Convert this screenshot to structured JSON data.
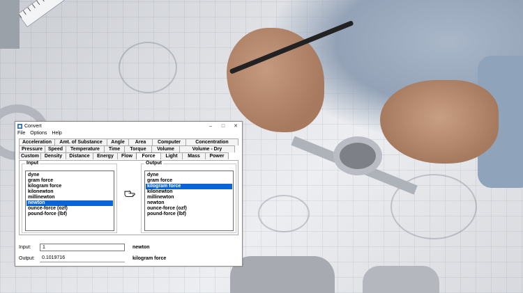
{
  "window": {
    "title": "Convert",
    "controls": {
      "minimize": "–",
      "maximize": "□",
      "close": "✕"
    }
  },
  "menu": [
    "File",
    "Options",
    "Help"
  ],
  "tabs": {
    "row1": [
      "Acceleration",
      "Amt. of Substance",
      "Angle",
      "Area",
      "Computer",
      "Concentration"
    ],
    "row2": [
      "Pressure",
      "Speed",
      "Temperature",
      "Time",
      "Torque",
      "Volume",
      "Volume - Dry"
    ],
    "row3": [
      "Custom",
      "Density",
      "Distance",
      "Energy",
      "Flow",
      "Force",
      "Light",
      "Mass",
      "Power"
    ],
    "active": "Force"
  },
  "input_group": {
    "label": "Input",
    "items": [
      "dyne",
      "gram force",
      "kilogram force",
      "kilonewton",
      "millinewton",
      "newton",
      "ounce-force (ozf)",
      "pound-force (lbf)"
    ],
    "selected": "newton"
  },
  "output_group": {
    "label": "Output",
    "items": [
      "dyne",
      "gram force",
      "kilogram force",
      "kilonewton",
      "millinewton",
      "newton",
      "ounce-force (ozf)",
      "pound-force (lbf)"
    ],
    "selected": "kilogram force"
  },
  "input_field": {
    "label": "Input:",
    "value": "1",
    "unit": "newton"
  },
  "output_field": {
    "label": "Output:",
    "value": "0.1019716",
    "unit": "kilogram force"
  },
  "colors": {
    "selection": "#0a64d6",
    "window_bg": "#ffffff"
  }
}
